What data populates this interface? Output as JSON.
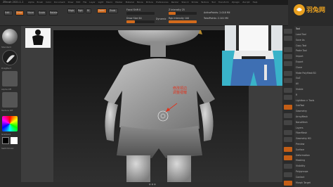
{
  "app": {
    "title": "ZBrush 2021.1.1",
    "menus": [
      "Alpha",
      "Brush",
      "Color",
      "Document",
      "Draw",
      "Edit",
      "File",
      "Layer",
      "Light",
      "Macro",
      "Marker",
      "Material",
      "Movie",
      "Picture",
      "Preferences",
      "Render",
      "Stencil",
      "Stroke",
      "Texture",
      "Tool",
      "Transform",
      "Zplugin",
      "Zscript",
      "Help"
    ]
  },
  "toolbar": {
    "edit_label": "Edit",
    "draw_label": "Draw",
    "move_label": "Move",
    "scale_label": "Scale",
    "rotate_label": "Rotate",
    "mrgb_label": "Mrgb",
    "rgb_label": "Rgb",
    "m_label": "M",
    "zadd_label": "Zadd",
    "zsub_label": "Zsub",
    "focal_label": "Focal Shift 0",
    "draw_size_label": "Draw Size 64",
    "dynamic_label": "Dynamic",
    "z_intensity_label": "Z Intensity 25",
    "rgb_intensity_label": "Rgb Intensity 100",
    "active_points": "ActivePoints: 2.018 Mil",
    "total_points": "TotalPoints: 2.101 Mil",
    "focal_value": 0.0,
    "draw_size_value": 0.3,
    "z_intensity_value": 0.25,
    "rgb_intensity_value": 1.0
  },
  "shelf": {
    "tools": [
      "Standard",
      "Stroke",
      "Alpha",
      "Texture",
      "Material",
      "Color"
    ],
    "labels": [
      "Standard",
      "DragRect",
      "Alpha Off",
      "Texture Off",
      "MatCap",
      "Gradient",
      "SwitchColor"
    ]
  },
  "annotation": {
    "line1": "修改领边",
    "line2": "调整褶皱"
  },
  "logo": {
    "text": "羽兔网",
    "color": "#e8a020"
  },
  "tray": {
    "title": "Tool",
    "items": [
      "Load Tool",
      "Save As",
      "Copy Tool",
      "Paste Tool",
      "Import",
      "Export",
      "Clone",
      "Make PolyMesh3D",
      "GoZ",
      "All",
      "Visible",
      "R",
      "Lightbox > Tools",
      "SubTool",
      "Geometry",
      "ArrayMesh",
      "NanoMesh",
      "Layers",
      "FiberMesh",
      "Geometry HD",
      "Preview",
      "Surface",
      "Deformation",
      "Masking",
      "Visibility",
      "Polygroups",
      "Contact",
      "Morph Target"
    ]
  },
  "status": {
    "bottom": "● ● ●"
  },
  "colors": {
    "accent": "#d26a1c",
    "annotation": "#e0321c"
  }
}
